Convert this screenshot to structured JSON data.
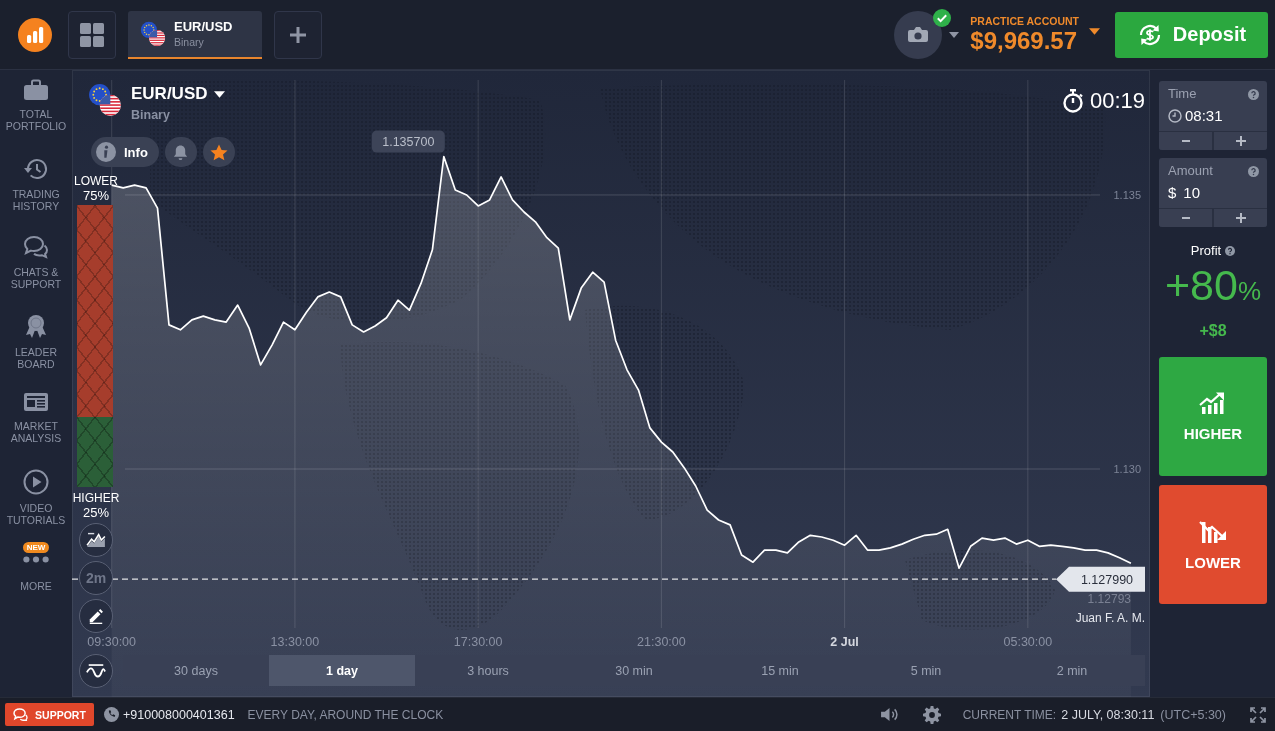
{
  "top_bar": {
    "asset_tabs": [
      {
        "title": "EUR/USD",
        "subtitle": "Binary",
        "selected": true
      }
    ],
    "account": {
      "label": "PRACTICE ACCOUNT",
      "balance": "$9,969.57",
      "verified": true
    },
    "deposit_button": "Deposit"
  },
  "sidebar": {
    "items": [
      {
        "label": "TOTAL PORTFOLIO"
      },
      {
        "label": "TRADING HISTORY"
      },
      {
        "label": "CHATS & SUPPORT"
      },
      {
        "label": "LEADER BOARD"
      },
      {
        "label": "MARKET ANALYSIS"
      },
      {
        "label": "VIDEO TUTORIALS"
      },
      {
        "label": "MORE",
        "badge": "NEW"
      }
    ]
  },
  "chart": {
    "asset": {
      "title": "EUR/USD",
      "subtitle": "Binary"
    },
    "info_button": "Info",
    "favorite": true,
    "timer": "00:19",
    "sentiment": {
      "lower_label": "LOWER",
      "lower_value": "75%",
      "higher_label": "HIGHER",
      "higher_value": "25%",
      "level": 0.75
    },
    "interval_button": "2m",
    "chart_data": {
      "type": "area",
      "color": "#ffffff",
      "x": [
        "--07-01T09:30",
        "--07-01T09:45",
        "--07-01T10:00",
        "--07-01T10:15",
        "--07-01T10:30",
        "--07-01T10:45",
        "--07-01T11:00",
        "--07-01T11:15",
        "--07-01T11:30",
        "--07-01T11:45",
        "--07-01T12:00",
        "--07-01T12:15",
        "--07-01T12:30",
        "--07-01T12:45",
        "--07-01T13:00",
        "--07-01T13:15",
        "--07-01T13:30",
        "--07-01T13:45",
        "--07-01T14:00",
        "--07-01T14:15",
        "--07-01T14:30",
        "--07-01T14:45",
        "--07-01T15:00",
        "--07-01T15:15",
        "--07-01T15:30",
        "--07-01T15:45",
        "--07-01T16:00",
        "--07-01T16:15",
        "--07-01T16:30",
        "--07-01T16:45",
        "--07-01T17:00",
        "--07-01T17:15",
        "--07-01T17:30",
        "--07-01T17:45",
        "--07-01T18:00",
        "--07-01T18:15",
        "--07-01T18:30",
        "--07-01T18:45",
        "--07-01T19:00",
        "--07-01T19:15",
        "--07-01T19:30",
        "--07-01T19:45",
        "--07-01T20:00",
        "--07-01T20:15",
        "--07-01T20:30",
        "--07-01T20:45",
        "--07-01T21:00",
        "--07-01T21:15",
        "--07-01T21:30",
        "--07-01T21:45",
        "--07-01T22:00",
        "--07-01T22:15",
        "--07-01T22:30",
        "--07-01T22:45",
        "--07-01T23:00",
        "--07-01T23:15",
        "--07-01T23:30",
        "--07-01T23:45",
        "--07-02T00:00",
        "--07-02T00:15",
        "--07-02T00:30",
        "--07-02T00:45",
        "--07-02T01:00",
        "--07-02T01:15",
        "--07-02T01:30",
        "--07-02T01:45",
        "--07-02T02:00",
        "--07-02T02:15",
        "--07-02T02:30",
        "--07-02T02:45",
        "--07-02T03:00",
        "--07-02T03:15",
        "--07-02T03:30",
        "--07-02T03:45",
        "--07-02T04:00",
        "--07-02T04:15",
        "--07-02T04:30",
        "--07-02T04:45",
        "--07-02T05:00",
        "--07-02T05:15",
        "--07-02T05:30",
        "--07-02T05:45",
        "--07-02T06:00",
        "--07-02T06:15",
        "--07-02T06:30",
        "--07-02T06:45",
        "--07-02T07:00",
        "--07-02T07:15",
        "--07-02T07:30",
        "--07-02T07:45"
      ],
      "values": [
        1.13518,
        1.13513,
        1.13518,
        1.13513,
        1.13476,
        1.13263,
        1.13254,
        1.13272,
        1.13279,
        1.13272,
        1.13268,
        1.13299,
        1.13257,
        1.1319,
        1.13226,
        1.13268,
        1.13254,
        1.13286,
        1.13314,
        1.13323,
        1.13314,
        1.13263,
        1.1325,
        1.13261,
        1.13276,
        1.13308,
        1.1329,
        1.13338,
        1.134,
        1.1357,
        1.13509,
        1.135,
        1.1348,
        1.13491,
        1.13533,
        1.13491,
        1.13469,
        1.13451,
        1.13422,
        1.13403,
        1.13272,
        1.1333,
        1.13359,
        1.13341,
        1.13235,
        1.13181,
        1.13144,
        1.13075,
        1.13049,
        1.13031,
        1.13002,
        1.12969,
        1.12925,
        1.12907,
        1.12898,
        1.12843,
        1.1283,
        1.12852,
        1.12852,
        1.12847,
        1.12867,
        1.12879,
        1.12876,
        1.1287,
        1.12861,
        1.12879,
        1.12852,
        1.12852,
        1.12856,
        1.12863,
        1.12872,
        1.12879,
        1.12881,
        1.1289,
        1.12819,
        1.12859,
        1.12874,
        1.1287,
        1.12874,
        1.12863,
        1.1287,
        1.12859,
        1.12861,
        1.12859,
        1.12856,
        1.12852,
        1.12852,
        1.12847,
        1.12838,
        1.12828
      ],
      "xlim": [
        "--07-01T08:38",
        "--07-02T08:10"
      ],
      "ylim": [
        1.12584,
        1.13728
      ],
      "xticks": [
        {
          "value": "--07-01T09:30",
          "label": "09:30:00"
        },
        {
          "value": "--07-01T13:30",
          "label": "13:30:00"
        },
        {
          "value": "--07-01T17:30",
          "label": "17:30:00"
        },
        {
          "value": "--07-01T21:30",
          "label": "21:30:00"
        },
        {
          "value": "--07-02T01:30",
          "label": "2 Jul"
        },
        {
          "value": "--07-02T05:30",
          "label": "05:30:00"
        }
      ],
      "yticks": [
        {
          "value": 1.13,
          "label": "1.130"
        },
        {
          "value": 1.135,
          "label": "1.135"
        }
      ],
      "grid": true,
      "ref_lines": [
        {
          "axis": "y",
          "value": 1.12799,
          "label": "1.127990",
          "color": "#ffffff",
          "line_style": "dashed"
        }
      ],
      "annotations": [
        "1.135700"
      ]
    },
    "trader": {
      "price": "1.12793",
      "name": "Juan F. A. M."
    },
    "periods": [
      {
        "label": "30 days",
        "selected": false
      },
      {
        "label": "1 day",
        "selected": true
      },
      {
        "label": "3 hours",
        "selected": false
      },
      {
        "label": "30 min",
        "selected": false
      },
      {
        "label": "15 min",
        "selected": false
      },
      {
        "label": "5 min",
        "selected": false
      },
      {
        "label": "2 min",
        "selected": false
      }
    ]
  },
  "trade_panel": {
    "time": {
      "label": "Time",
      "value": "08:31"
    },
    "amount": {
      "label": "Amount",
      "currency": "$",
      "value": "10"
    },
    "profit": {
      "label": "Profit",
      "percent": "+80",
      "unit": "%",
      "amount": "+$8"
    },
    "higher_button": "HIGHER",
    "lower_button": "LOWER"
  },
  "status_bar": {
    "support_button": "SUPPORT",
    "phone": "+910008000401361",
    "hours": "EVERY DAY, AROUND THE CLOCK",
    "current_time_label": "CURRENT TIME:",
    "current_time": "2 JULY, 08:30:11",
    "timezone": "(UTC+5:30)"
  }
}
